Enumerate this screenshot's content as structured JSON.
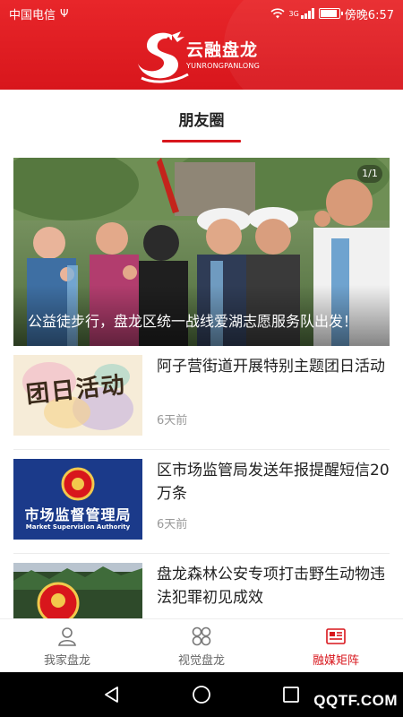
{
  "status_bar": {
    "carrier": "中国电信",
    "network_label": "3G",
    "time": "傍晚6:57",
    "battery_level": 0.9,
    "icons": [
      "usb-icon",
      "wifi-icon",
      "signal-icon",
      "battery-icon"
    ]
  },
  "header": {
    "logo_cn": "云融盘龙",
    "logo_en": "YUNRONGPANLONG",
    "background_color": "#d8161c"
  },
  "tab": {
    "title": "朋友圈",
    "accent_color": "#d8161c"
  },
  "hero": {
    "counter": "1/1",
    "caption": "公益徒步行，盘龙区统一战线爱湖志愿服务队出发！"
  },
  "news": [
    {
      "title": "阿子营街道开展特别主题团日活动",
      "time": "6天前",
      "thumb_text": "团日活动"
    },
    {
      "title": "区市场监管局发送年报提醒短信20万条",
      "time": "6天前",
      "thumb_text": "市场监督管理局",
      "thumb_subtext": "Market Supervision Authority"
    },
    {
      "title": "盘龙森林公安专项打击野生动物违法犯罪初见成效",
      "time": ""
    }
  ],
  "bottom_tabs": [
    {
      "label": "我家盘龙",
      "icon": "person-icon",
      "active": false
    },
    {
      "label": "视觉盘龙",
      "icon": "clover-icon",
      "active": false
    },
    {
      "label": "融媒矩阵",
      "icon": "newspaper-icon",
      "active": true
    }
  ],
  "nav": {
    "icons": [
      "back-icon",
      "home-icon",
      "recent-apps-icon"
    ]
  },
  "watermark": "QQTF.COM"
}
